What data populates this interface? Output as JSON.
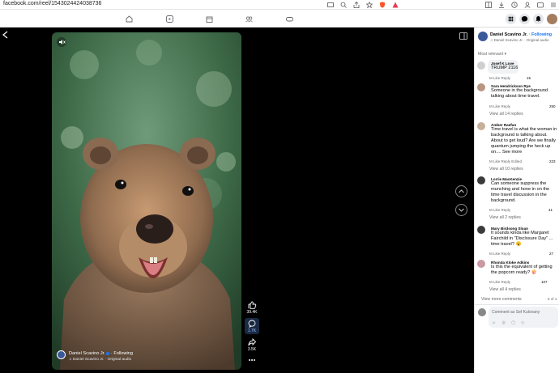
{
  "browser": {
    "url": "facebook.com/reel/1543024424038736"
  },
  "reel": {
    "author": "Daniel Scavino Jr.",
    "following": "· Following",
    "audio": "♫ Daniel Scavino Jr. · Original audio",
    "likes": "39.4K",
    "comments": "1.7K",
    "shares": "3.5K"
  },
  "panel": {
    "header_name": "Daniel Scavino Jr.",
    "header_following": "· Following",
    "header_audio": "♫ Daniel Scavino Jr. · Original audio",
    "sort": "Most relevant",
    "comments": [
      {
        "name": "Josef K Love",
        "text": "TRUMP 2116",
        "actions": "M     Like     Reply",
        "count": "15"
      },
      {
        "name": "Sara Hendrickson Rye",
        "text": "Someone in the background talking about time travel.",
        "actions": "M     Like     Reply",
        "count": "250",
        "replies": "View all 14 replies"
      },
      {
        "name": "Amber Raefan",
        "text": "Time travel is what the woman in background is talking about. About to get loud? Are we finally quantum jumping the heck up on.... See more",
        "actions": "M     Like     Reply     Edited",
        "count": "223",
        "replies": "View all 10 replies"
      },
      {
        "name": "Lorrie MacKenzie",
        "text": "Can someone suppress the munching and hone in on the time travel discussion in the background.",
        "actions": "M     Like     Reply",
        "count": "41",
        "replies": "View all 2 replies"
      },
      {
        "name": "Mary Birdsong Sloan",
        "text": "It sounds kinda like Margaret Fairchild in \"Disclosure Day\" ... time travel? 😮",
        "actions": "M     Like     Reply",
        "count": "27"
      },
      {
        "name": "Rhonda Kloke Adkins",
        "text": "Is this the equivalent of getting the popcorn ready? 🍿",
        "actions": "M     Like     Reply",
        "count": "107",
        "replies": "View all 4 replies"
      }
    ],
    "view_more": "View more comments",
    "pagination": "6 of 1.",
    "comment_placeholder": "Comment as Sef Kulovany"
  },
  "colors": {
    "fb_blue": "#1877f2",
    "bg_dark": "#000000",
    "meta_gray": "#65676b"
  },
  "icons": [
    "back-icon",
    "home-icon",
    "reels-icon",
    "marketplace-icon",
    "groups-icon",
    "gaming-icon",
    "menu-icon",
    "messenger-icon",
    "bell-icon",
    "mute-icon",
    "like-icon",
    "comment-icon",
    "share-icon",
    "more-icon",
    "chevron-up-icon",
    "chevron-down-icon"
  ]
}
